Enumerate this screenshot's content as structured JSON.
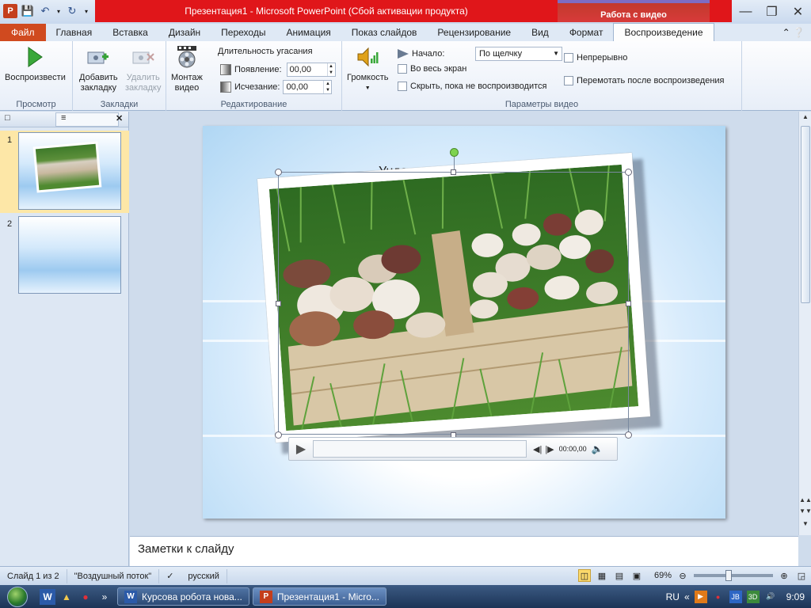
{
  "window": {
    "title": "Презентация1 - Microsoft PowerPoint (Сбой активации продукта)",
    "context_tab": "Работа с видео"
  },
  "tabs": [
    {
      "label": "Файл"
    },
    {
      "label": "Главная"
    },
    {
      "label": "Вставка"
    },
    {
      "label": "Дизайн"
    },
    {
      "label": "Переходы"
    },
    {
      "label": "Анимация"
    },
    {
      "label": "Показ слайдов"
    },
    {
      "label": "Рецензирование"
    },
    {
      "label": "Вид"
    },
    {
      "label": "Формат"
    },
    {
      "label": "Воспроизведение"
    }
  ],
  "ribbon": {
    "preview": {
      "play_label": "Воспроизвести",
      "group_label": "Просмотр"
    },
    "bookmarks": {
      "add_label_1": "Добавить",
      "add_label_2": "закладку",
      "remove_label_1": "Удалить",
      "remove_label_2": "закладку",
      "group_label": "Закладки"
    },
    "editing": {
      "trim_label_1": "Монтаж",
      "trim_label_2": "видео",
      "fade_title": "Длительность угасания",
      "fade_in_label": "Появление:",
      "fade_in_value": "00,00",
      "fade_out_label": "Исчезание:",
      "fade_out_value": "00,00",
      "group_label": "Редактирование"
    },
    "video_options": {
      "volume_label": "Громкость",
      "start_label": "Начало:",
      "start_value": "По щелчку",
      "fullscreen_label": "Во весь экран",
      "hide_label": "Скрыть, пока не воспроизводится",
      "loop_label": "Непрерывно",
      "rewind_label": "Перемотать после воспроизведения",
      "group_label": "Параметры видео"
    }
  },
  "slides_pane": {
    "slides": [
      {
        "number": "1",
        "selected": true
      },
      {
        "number": "2",
        "selected": false
      }
    ]
  },
  "slide": {
    "title_fragment": "Ундес"
  },
  "player": {
    "time": "00:00,00"
  },
  "notes": {
    "placeholder": "Заметки к слайду"
  },
  "status": {
    "slide_counter": "Слайд 1 из 2",
    "theme": "\"Воздушный поток\"",
    "language": "русский",
    "zoom": "69%"
  },
  "taskbar": {
    "tasks": [
      {
        "label": "Курсова робота нова..."
      },
      {
        "label": "Презентация1 - Micro..."
      }
    ],
    "lang": "RU",
    "clock": "9:09"
  }
}
